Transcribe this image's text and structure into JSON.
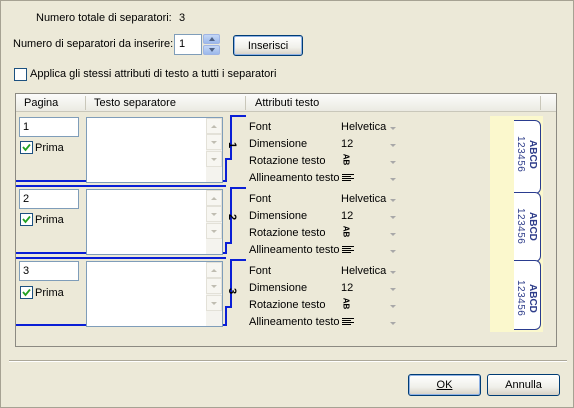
{
  "summary": {
    "total_label": "Numero totale di separatori:",
    "total_value": "3",
    "insert_label": "Numero di separatori da inserire:",
    "insert_value": "1",
    "insert_button": "Inserisci",
    "apply_all_label": "Applica gli stessi attributi di testo a tutti i separatori",
    "apply_all_checked": false
  },
  "columns": [
    "Pagina",
    "Testo separatore",
    "Attributi testo"
  ],
  "attribute_labels": {
    "font": "Font",
    "size": "Dimensione",
    "rotation": "Rotazione testo",
    "alignment": "Allineamento testo"
  },
  "rows": [
    {
      "page": "1",
      "first_label": "Prima",
      "first_checked": true,
      "text": "",
      "number": "1",
      "font": "Helvetica",
      "size": "12",
      "rotation_icon": "AB"
    },
    {
      "page": "2",
      "first_label": "Prima",
      "first_checked": true,
      "text": "",
      "number": "2",
      "font": "Helvetica",
      "size": "12",
      "rotation_icon": "AB"
    },
    {
      "page": "3",
      "first_label": "Prima",
      "first_checked": true,
      "text": "",
      "number": "3",
      "font": "Helvetica",
      "size": "12",
      "rotation_icon": "AB"
    }
  ],
  "preview": {
    "tabs": [
      {
        "title": "ABCD",
        "digits": "123456"
      },
      {
        "title": "ABCD",
        "digits": "123456"
      },
      {
        "title": "ABCD",
        "digits": "123456"
      }
    ],
    "tab_color": "#2e3d8a",
    "background": "#fbf8cd"
  },
  "footer": {
    "ok_label": "OK",
    "cancel_label": "Annulla"
  },
  "colors": {
    "dialog_bg": "#ece9d8",
    "row_border": "#0a1fd6"
  }
}
